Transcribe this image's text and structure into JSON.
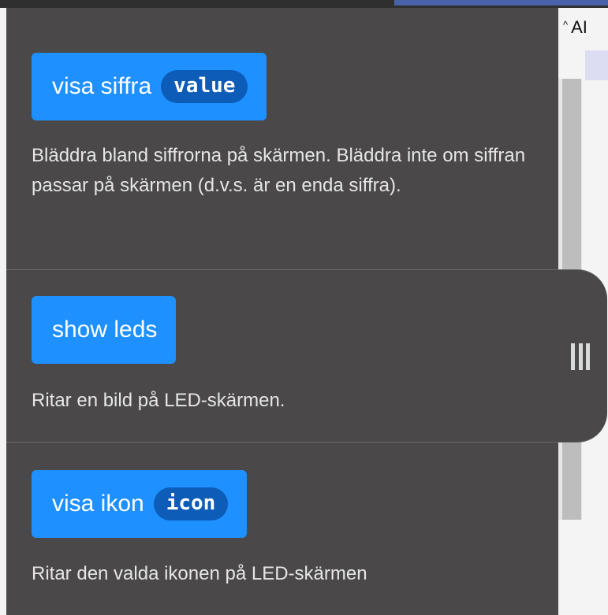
{
  "side_panel": {
    "header_caret": "^",
    "header_text": "AI"
  },
  "flyout": {
    "blocks": [
      {
        "label": "visa siffra",
        "param": "value",
        "description": "Bläddra bland siffrorna på skärmen. Bläddra inte om siffran passar på skärmen (d.v.s. är en enda siffra)."
      },
      {
        "label": "show leds",
        "param": "",
        "description": "Ritar en bild på LED-skärmen."
      },
      {
        "label": "visa ikon",
        "param": "icon",
        "description": "Ritar den valda ikonen på LED-skärmen"
      }
    ]
  },
  "colors": {
    "flyout_bg": "#4a4848",
    "block_blue": "#1e90ff",
    "param_pill": "#0c5cb8",
    "description_text": "#e6e6e6"
  },
  "icons": {
    "resize_handle": "drag-handle-icon",
    "collapse_caret": "caret-up-icon"
  }
}
